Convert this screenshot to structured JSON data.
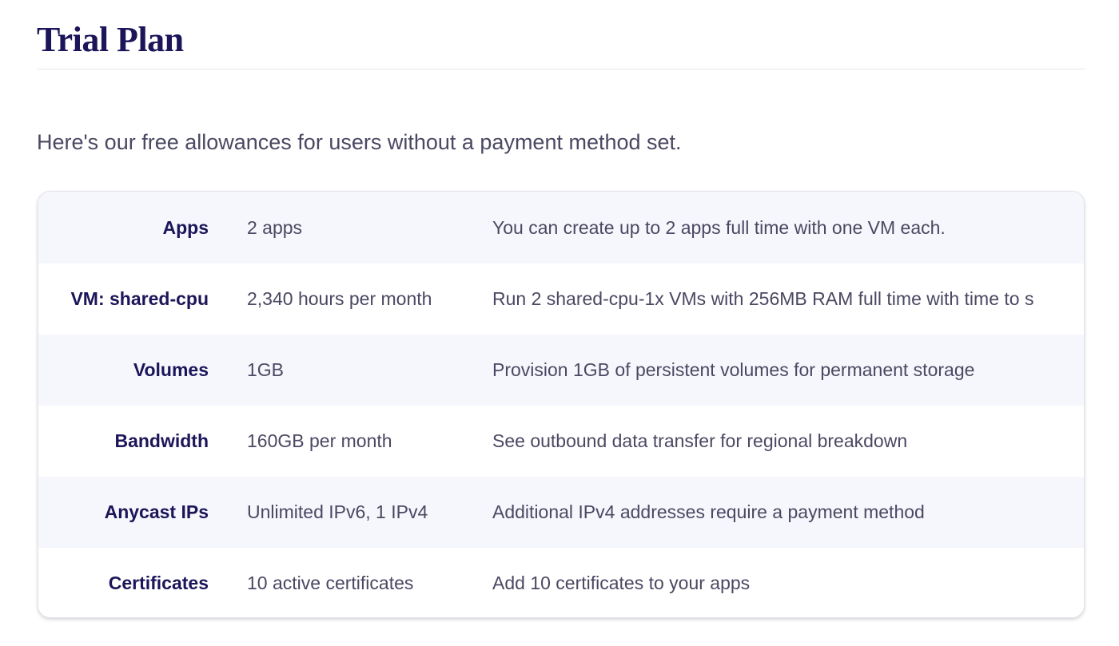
{
  "page": {
    "title": "Trial Plan",
    "intro": "Here's our free allowances for users without a payment method set."
  },
  "allowances": [
    {
      "label": "Apps",
      "amount": "2 apps",
      "description": "You can create up to 2 apps full time with one VM each."
    },
    {
      "label": "VM: shared-cpu",
      "amount": "2,340 hours per month",
      "description": "Run 2 shared-cpu-1x VMs with 256MB RAM full time with time to s"
    },
    {
      "label": "Volumes",
      "amount": "1GB",
      "description": "Provision 1GB of persistent volumes for permanent storage"
    },
    {
      "label": "Bandwidth",
      "amount": "160GB per month",
      "description": "See outbound data transfer for regional breakdown"
    },
    {
      "label": "Anycast IPs",
      "amount": "Unlimited IPv6, 1 IPv4",
      "description": "Additional IPv4 addresses require a payment method"
    },
    {
      "label": "Certificates",
      "amount": "10 active certificates",
      "description": "Add 10 certificates to your apps"
    }
  ],
  "colors": {
    "heading": "#1c1559",
    "body_text": "#4a4862",
    "row_alt": "#f6f7fc",
    "border": "#e3e3ea"
  }
}
